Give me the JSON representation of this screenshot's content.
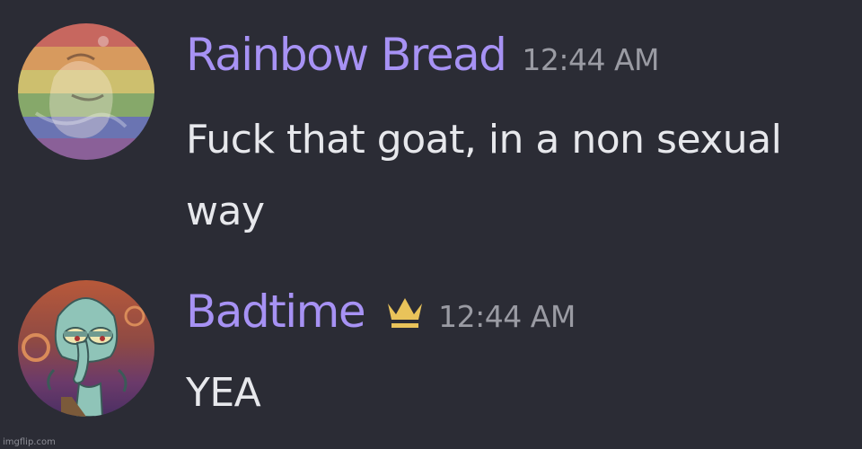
{
  "messages": [
    {
      "username": "Rainbow Bread",
      "timestamp": "12:44 AM",
      "text": "Fuck that goat, in a non sexual way",
      "avatar_icon": "rainbow-pride-avatar",
      "username_color": "#a792f4"
    },
    {
      "username": "Badtime",
      "timestamp": "12:44 AM",
      "text": "YEA",
      "avatar_icon": "squidward-avatar",
      "badge_icon": "crown-icon",
      "badge_color": "#e9c35a",
      "username_color": "#a792f4"
    }
  ],
  "watermark": "imgflip.com",
  "colors": {
    "background": "#2b2c35",
    "message_text": "#e7e8ec",
    "timestamp": "#9a9ba3"
  }
}
